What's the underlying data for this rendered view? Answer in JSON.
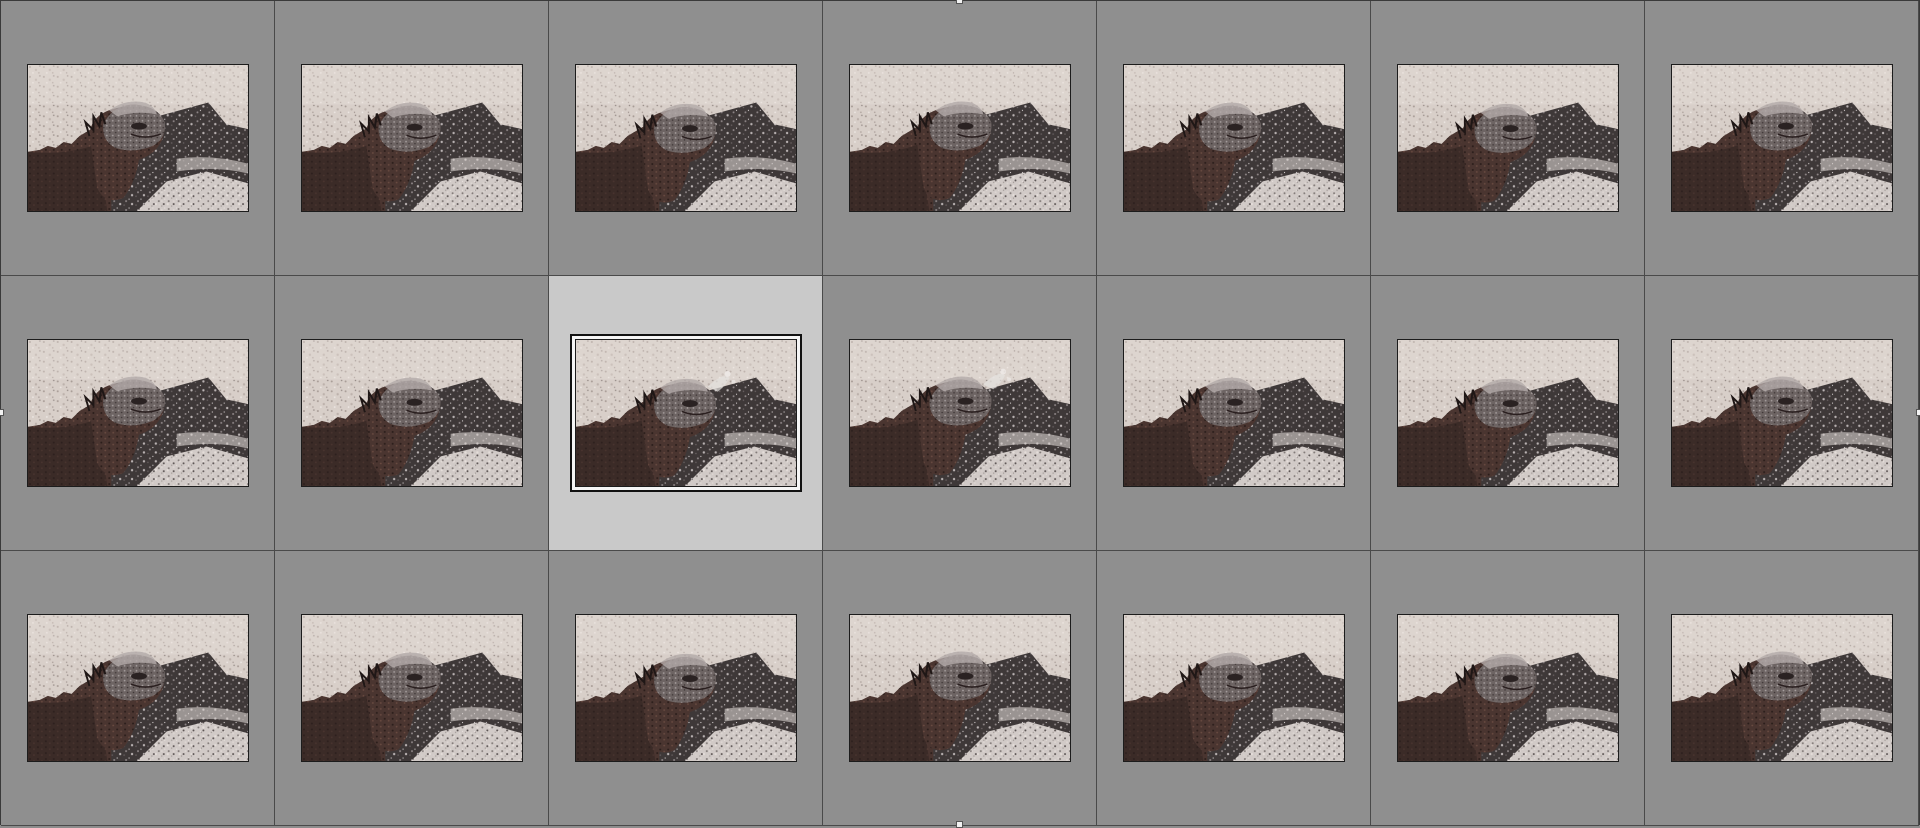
{
  "grid": {
    "columns": 7,
    "rows": 3,
    "selected_index": 9,
    "thumbnail_subject": "marine-iguana-photo",
    "colors": {
      "cell_background": "#8f8f8f",
      "selected_background": "#c9c9c9",
      "grid_line": "#4a4a4a"
    }
  },
  "thumbnails": [
    {
      "pose": 0
    },
    {
      "pose": 1
    },
    {
      "pose": 2
    },
    {
      "pose": 3
    },
    {
      "pose": 4
    },
    {
      "pose": 5
    },
    {
      "pose": 6
    },
    {
      "pose": 0
    },
    {
      "pose": 1
    },
    {
      "pose": 2,
      "spray": true
    },
    {
      "pose": 3,
      "spray": true
    },
    {
      "pose": 4
    },
    {
      "pose": 5
    },
    {
      "pose": 6
    },
    {
      "pose": 0
    },
    {
      "pose": 1
    },
    {
      "pose": 2
    },
    {
      "pose": 3
    },
    {
      "pose": 4
    },
    {
      "pose": 5
    },
    {
      "pose": 6
    }
  ]
}
